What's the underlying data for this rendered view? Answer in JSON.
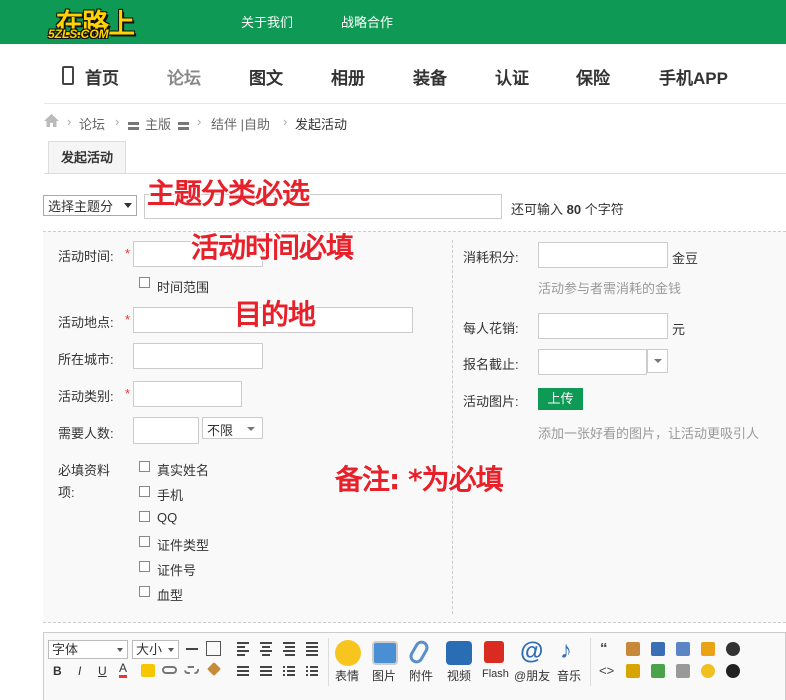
{
  "header": {
    "logo_main": "在路上",
    "logo_sub": "5ZLS.COM",
    "links": [
      "关于我们",
      "战略合作"
    ]
  },
  "nav": {
    "items": [
      "首页",
      "论坛",
      "图文",
      "相册",
      "装备",
      "认证",
      "保险",
      "手机APP"
    ]
  },
  "breadcrumb": {
    "items": [
      "论坛",
      "主版",
      "结伴 |自助",
      "发起活动"
    ]
  },
  "tab": {
    "label": "发起活动"
  },
  "subject": {
    "type_select": "选择主题分",
    "char_hint_prefix": "还可输入",
    "char_count": "80",
    "char_hint_suffix": "个字符"
  },
  "form": {
    "time_label": "活动时间:",
    "time_range_label": "时间范围",
    "place_label": "活动地点:",
    "city_label": "所在城市:",
    "category_label": "活动类别:",
    "people_label": "需要人数:",
    "people_select": "不限",
    "required_info_label_1": "必填资料",
    "required_info_label_2": "项:",
    "required_info_items": [
      "真实姓名",
      "手机",
      "QQ",
      "证件类型",
      "证件号",
      "血型"
    ],
    "required_mark": "*",
    "cost_points_label": "消耗积分:",
    "cost_points_unit": "金豆",
    "cost_points_hint": "活动参与者需消耗的金钱",
    "per_person_label": "每人花销:",
    "per_person_unit": "元",
    "deadline_label": "报名截止:",
    "image_label": "活动图片:",
    "upload_button": "上传",
    "image_hint": "添加一张好看的图片，让活动更吸引人"
  },
  "annotations": {
    "subject_note": "主题分类必选",
    "time_note": "活动时间必填",
    "place_note": "目的地",
    "remark_note": "备注: *为必填"
  },
  "editor": {
    "font_select": "字体",
    "size_select": "大小",
    "format_buttons": [
      "B",
      "I",
      "U",
      "A"
    ],
    "media_labels": [
      "表情",
      "图片",
      "附件",
      "视频",
      "Flash",
      "@朋友",
      "音乐"
    ]
  },
  "colors": {
    "brand_green": "#0e9a55",
    "annotation_red": "#e8202a",
    "required_red": "#e33"
  }
}
